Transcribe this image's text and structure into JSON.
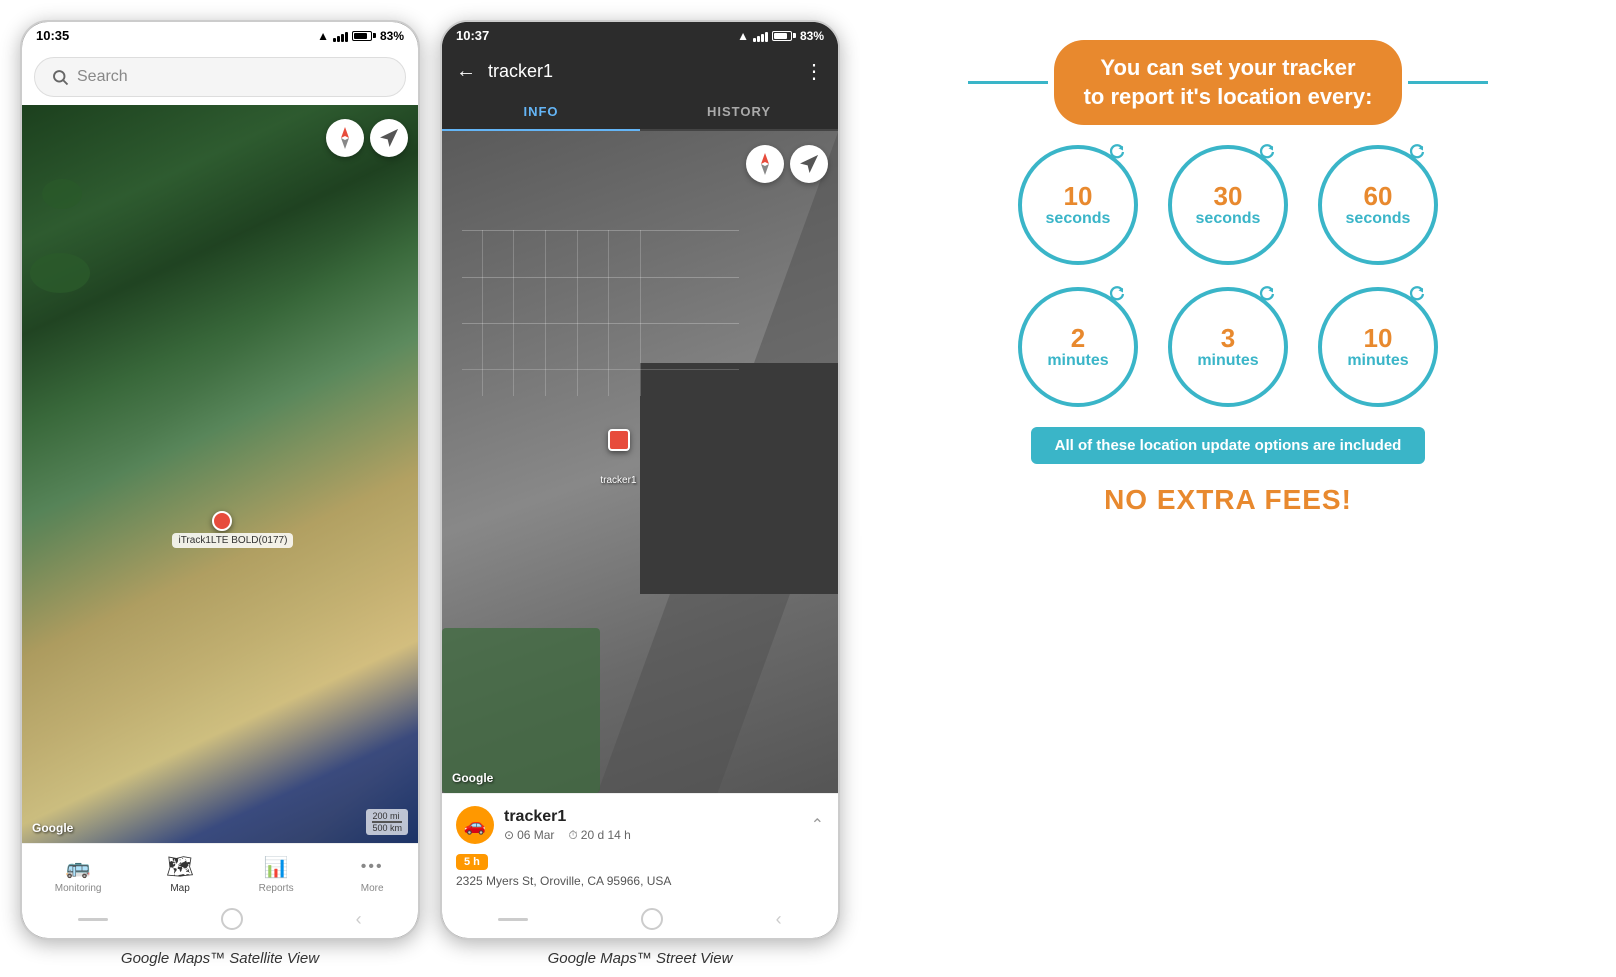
{
  "phone1": {
    "status_time": "10:35",
    "status_signal": "83%",
    "search_placeholder": "Search",
    "tracker_label": "iTrack1LTE BOLD(0177)",
    "google_branding": "Google",
    "scale_text": "200 mi\n500 km",
    "nav_items": [
      {
        "label": "Monitoring",
        "icon": "🚌",
        "active": false
      },
      {
        "label": "Map",
        "icon": "📍",
        "active": true
      },
      {
        "label": "Reports",
        "icon": "📊",
        "active": false
      },
      {
        "label": "More",
        "icon": "···",
        "active": false
      }
    ],
    "caption": "Google Maps™ Satellite View"
  },
  "phone2": {
    "status_time": "10:37",
    "status_signal": "83%",
    "tracker_name": "tracker1",
    "tabs": [
      {
        "label": "INFO",
        "active": true
      },
      {
        "label": "HISTORY",
        "active": false
      }
    ],
    "google_branding": "Google",
    "tracker_label": "tracker1",
    "info": {
      "name": "tracker1",
      "date": "06 Mar",
      "duration": "20 d 14 h",
      "time_badge": "5 h",
      "address": "2325 Myers St, Oroville, CA 95966, USA"
    },
    "caption": "Google Maps™ Street View"
  },
  "infographic": {
    "title_line1": "You can set your tracker",
    "title_line2": "to report it's location every:",
    "circles": [
      {
        "number": "10",
        "unit": "seconds"
      },
      {
        "number": "30",
        "unit": "seconds"
      },
      {
        "number": "60",
        "unit": "seconds"
      },
      {
        "number": "2",
        "unit": "minutes"
      },
      {
        "number": "3",
        "unit": "minutes"
      },
      {
        "number": "10",
        "unit": "minutes"
      }
    ],
    "included_text": "All of these location update options are included",
    "no_fees_text": "NO EXTRA FEES!",
    "accent_color": "#e8892e",
    "blue_color": "#3ab5c8"
  }
}
